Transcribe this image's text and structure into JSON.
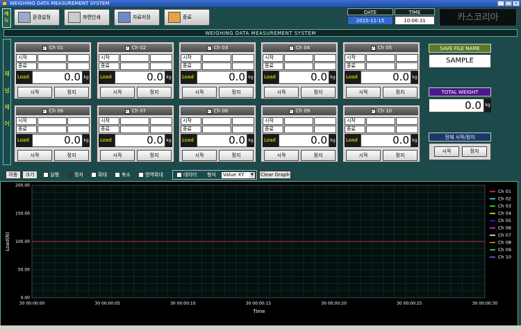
{
  "window": {
    "title": "WEIGHING DATA MEASUREMENT SYSTEM"
  },
  "toolbar": {
    "menu_side": "메뉴",
    "buttons": [
      {
        "label": "환경설정"
      },
      {
        "label": "화면인쇄"
      },
      {
        "label": "자료저장"
      },
      {
        "label": "종료"
      }
    ],
    "date_label": "DATE",
    "date_value": "2015-11-15",
    "time_label": "TIME",
    "time_value": "10:06:31",
    "brand": "카스코리아"
  },
  "banner": "WEIGHING DATA MEASUREMENT SYSTEM",
  "side_label": "채 널 제 어",
  "channel_row_labels": {
    "start": "시작",
    "end": "종료",
    "load": "Load",
    "unit": "kg"
  },
  "channel_buttons": {
    "start": "시작",
    "stop": "정지"
  },
  "channels": [
    {
      "name": "Ch 01",
      "load": "0.0"
    },
    {
      "name": "Ch 02",
      "load": "0.0"
    },
    {
      "name": "Ch 03",
      "load": "0.0"
    },
    {
      "name": "Ch 04",
      "load": "0.0"
    },
    {
      "name": "Ch 05",
      "load": "0.0"
    },
    {
      "name": "Ch 06",
      "load": "0.0"
    },
    {
      "name": "Ch 07",
      "load": "0.0"
    },
    {
      "name": "Ch 08",
      "load": "0.0"
    },
    {
      "name": "Ch 09",
      "load": "0.0"
    },
    {
      "name": "Ch 10",
      "load": "0.0"
    }
  ],
  "right_panel": {
    "save_file_label": "SAVE FILE NAME",
    "save_file_value": "SAMPLE",
    "total_weight_label": "TOTAL WEIGHT",
    "total_weight_value": "0.0",
    "total_weight_unit": "kg",
    "all_control_label": "전체 시작/정지",
    "all_start": "시작",
    "all_stop": "정지",
    "colors": {
      "save_hdr": "#5a7a2a",
      "weight_hdr": "#4a1a8a",
      "all_hdr": "#1a3a6a"
    }
  },
  "graph_toolbar": {
    "move": "이동",
    "size": "크기",
    "run": "실행",
    "stop": "정지",
    "zoom_in": "확대",
    "zoom_out": "축소",
    "area_zoom": "영역확대",
    "data": "데이터",
    "format_label": "형식",
    "format_value": "Value XY",
    "clear_graph": "Clear Graph"
  },
  "chart_data": {
    "type": "line",
    "xlabel": "Time",
    "ylabel": "Load(N)",
    "ylim": [
      0,
      200
    ],
    "yticks": [
      "0.00",
      "50.00",
      "100.00",
      "150.00",
      "200.00"
    ],
    "xticks": [
      "30 00:00:00",
      "30 00:00:05",
      "30 00:00:10",
      "30 00:00:15",
      "30 00:00:20",
      "30 00:00:25",
      "30 00:00:30"
    ],
    "reference_line": 100,
    "grid": true,
    "legend_position": "right",
    "series": [
      {
        "name": "Ch 01",
        "color": "#ff3333"
      },
      {
        "name": "Ch 02",
        "color": "#33ffff"
      },
      {
        "name": "Ch 03",
        "color": "#33ff33"
      },
      {
        "name": "Ch 04",
        "color": "#ffff33"
      },
      {
        "name": "Ch 05",
        "color": "#3333ff"
      },
      {
        "name": "Ch 06",
        "color": "#ff33ff"
      },
      {
        "name": "Ch 07",
        "color": "#ffffff"
      },
      {
        "name": "Ch 08",
        "color": "#ff9900"
      },
      {
        "name": "Ch 09",
        "color": "#33ff99"
      },
      {
        "name": "Ch 10",
        "color": "#9966ff"
      }
    ]
  }
}
